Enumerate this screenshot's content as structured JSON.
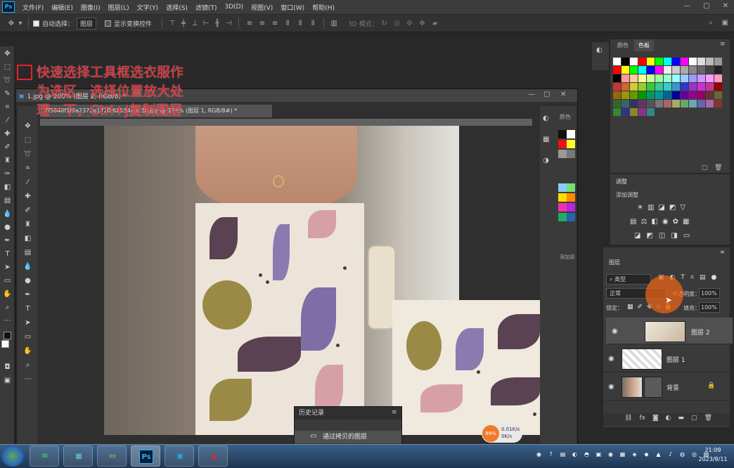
{
  "app": {
    "logo": "Ps"
  },
  "menu": [
    "文件(F)",
    "编辑(E)",
    "图像(I)",
    "图层(L)",
    "文字(Y)",
    "选择(S)",
    "滤镜(T)",
    "3D(D)",
    "视图(V)",
    "窗口(W)",
    "帮助(H)"
  ],
  "window_controls": [
    "—",
    "▢",
    "✕"
  ],
  "options": {
    "auto_select_label": "自动选择：",
    "auto_select_value": "图层",
    "show_transform_label": "显示变换控件",
    "mode_3d_label": "3D 模式："
  },
  "document": {
    "title": "1.jpg @ 200% (图层 2, RGB/8) *",
    "inner_tab": "7f5840f1f9a2372e1720f6b554a3c30.jpg  @  174%  (图层 1, RGB/8#) *"
  },
  "annotation": {
    "lines": [
      "快速选择工具框选衣服作",
      "为选区，选择位置放大处",
      "理一下，Ctrl+J复制图层"
    ],
    "color": "#e8202a"
  },
  "history": {
    "title": "历史记录",
    "entry": "通过拷贝的图层"
  },
  "net_widget": {
    "cpu": "89%",
    "up": "0.01K/s",
    "down": "0K/s"
  },
  "panels": {
    "color_tab": "颜色",
    "swatches_tab": "色板",
    "adjustments_title": "调整",
    "adjustments_add": "添加调整",
    "layers_title": "图层",
    "filter_kind": "类型",
    "blend_mode": "正常",
    "opacity_label": "不透明度：",
    "opacity_value": "100%",
    "lock_label": "锁定：",
    "fill_label": "填充：",
    "fill_value": "100%",
    "mini_color_tab": "颜色",
    "mini_add_adjust": "添加调"
  },
  "layers": [
    {
      "name": "图层 2",
      "selected": true
    },
    {
      "name": "图层 1",
      "selected": false
    },
    {
      "name": "背景",
      "selected": false,
      "locked": true
    }
  ],
  "taskbar": {
    "time": "21:09",
    "date": "2023/8/11",
    "apps": [
      "wechat-app",
      "calendar-app",
      "file-explorer-app",
      "photoshop-app",
      "image-viewer-app",
      "acrobat-app"
    ]
  },
  "colors": {
    "accent_blue": "#31a8ff",
    "panel_bg": "#3a3a3a",
    "workspace_bg": "#282828"
  }
}
